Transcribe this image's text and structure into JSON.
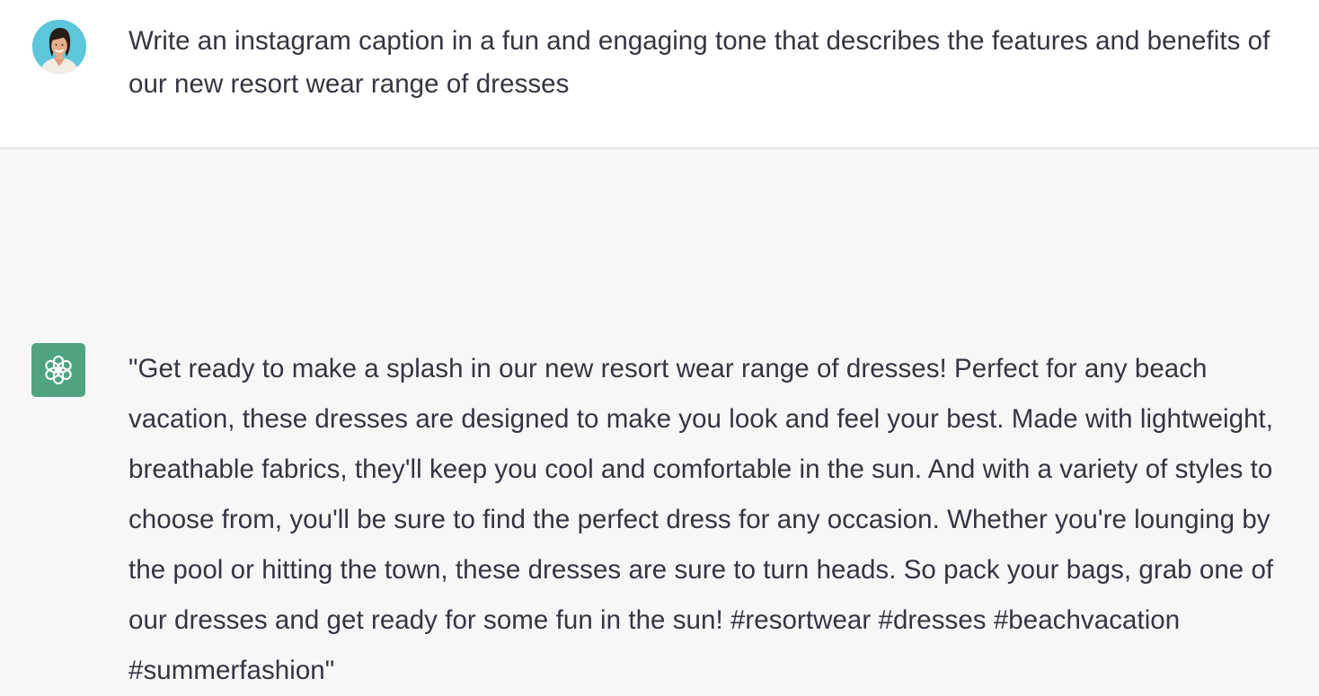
{
  "conversation": {
    "user": {
      "avatar_icon": "user-portrait-icon",
      "message": "Write an instagram caption in a fun and engaging tone that describes the features and benefits of our new resort wear range of dresses"
    },
    "assistant": {
      "avatar_icon": "chatgpt-logo-icon",
      "message": "\"Get ready to make a splash in our new resort wear range of dresses! Perfect for any beach vacation, these dresses are designed to make you look and feel your best. Made with lightweight, breathable fabrics, they'll keep you cool and comfortable in the sun. And with a variety of styles to choose from, you'll be sure to find the perfect dress for any occasion. Whether you're lounging by the pool or hitting the town, these dresses are sure to turn heads. So pack your bags, grab one of our dresses and get ready for some fun in the sun! #resortwear #dresses #beachvacation #summerfashion\""
    }
  },
  "colors": {
    "user_background": "#ffffff",
    "assistant_background": "#f7f7f8",
    "text": "#343541",
    "brand_green": "#4fa47f",
    "avatar_background": "#5cc6db"
  }
}
